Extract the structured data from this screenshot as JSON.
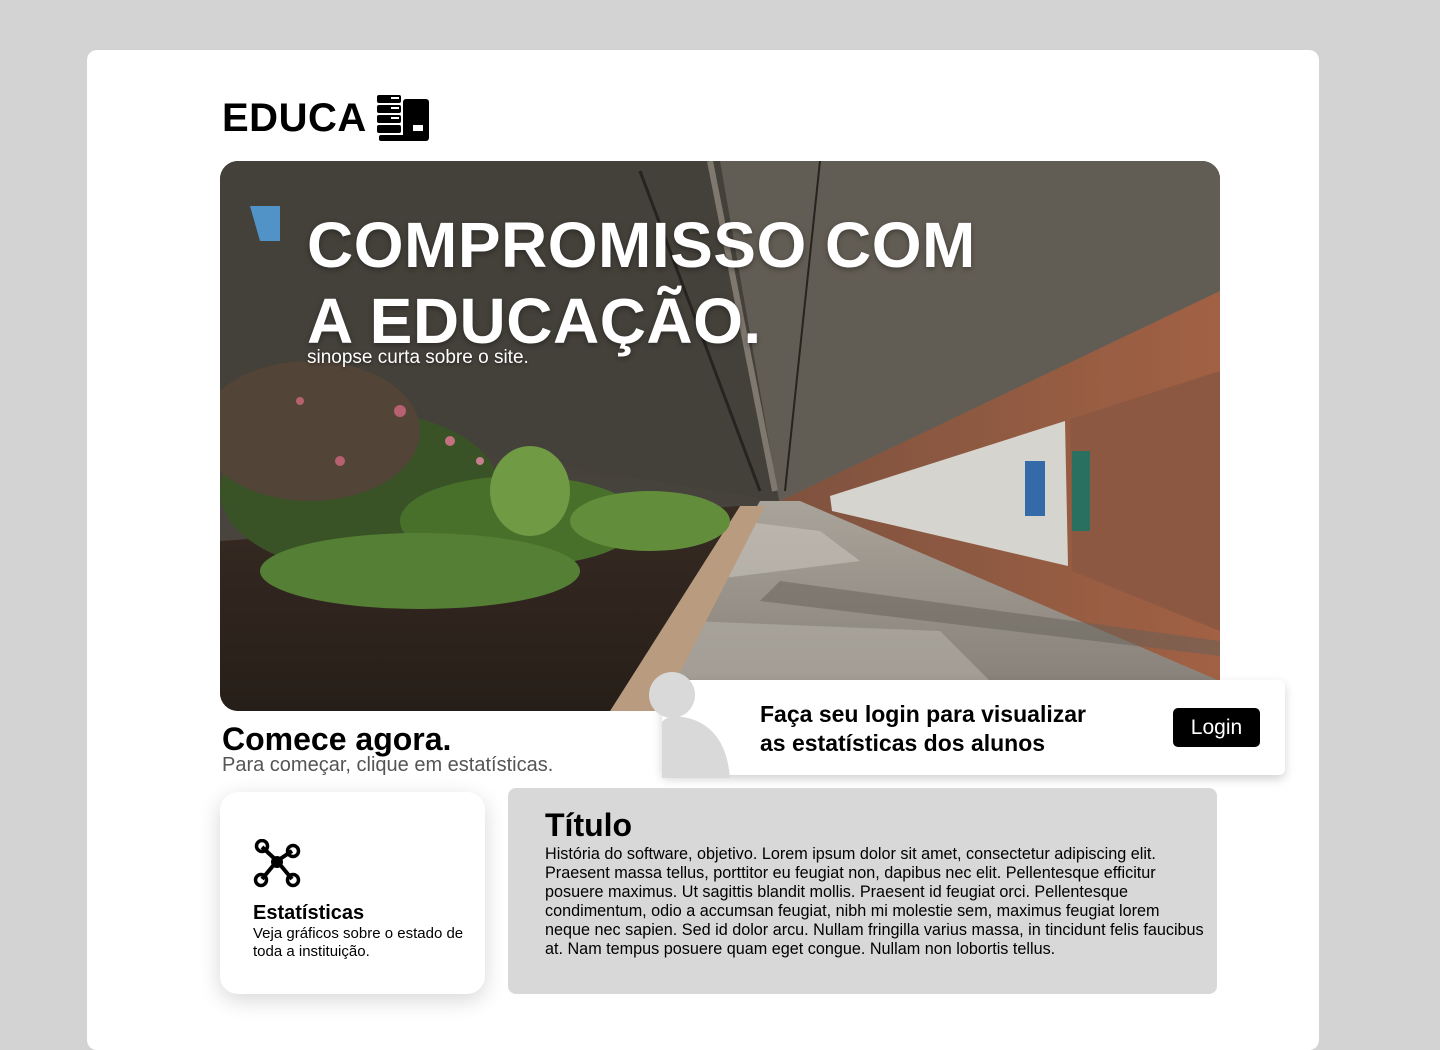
{
  "brand": {
    "name": "EDUCA",
    "icon": "server-icon"
  },
  "hero": {
    "title_line1": "COMPROMISSO COM",
    "title_line2": "A EDUCAÇÃO.",
    "subtitle": "sinopse curta sobre o site."
  },
  "start": {
    "title": "Comece agora.",
    "subtitle": "Para começar, clique em estatísticas."
  },
  "login_card": {
    "text_line1": "Faça seu login para visualizar",
    "text_line2": "as estatísticas dos alunos",
    "button_label": "Login",
    "avatar_icon": "user-icon"
  },
  "stats_card": {
    "icon": "network-icon",
    "title": "Estatísticas",
    "description": "Veja gráficos sobre o estado de toda a instituição."
  },
  "info": {
    "title": "Título",
    "body": "História do software, objetivo. Lorem ipsum dolor sit amet, consectetur adipiscing elit. Praesent massa  tellus, porttitor eu feugiat non, dapibus nec elit. Pellentesque  efficitur posuere maximus. Ut sagittis blandit mollis. Praesent id  feugiat orci. Pellentesque condimentum, odio a accumsan feugiat, nibh mi molestie sem, maximus feugiat lorem neque nec sapien. Sed id dolor  arcu. Nullam fringilla varius massa, in tincidunt felis faucibus at. Nam tempus posuere quam eget congue. Nullam non lobortis tellus."
  },
  "colors": {
    "background": "#d3d3d3",
    "card": "#ffffff",
    "info_box": "#d8d8d8",
    "button": "#000000"
  }
}
